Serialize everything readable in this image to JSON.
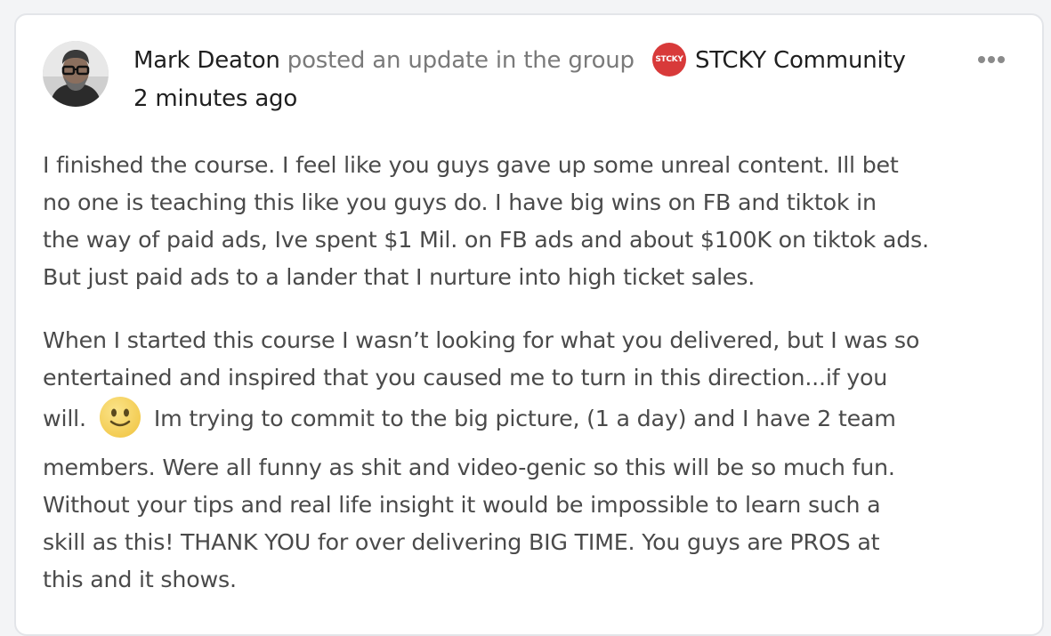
{
  "post": {
    "author": "Mark Deaton",
    "action_text": " posted an update in the group ",
    "group_badge_text": "STCKY",
    "group_name": "STCKY Community",
    "timestamp": "2 minutes ago",
    "more_icon": "more-horizontal-icon",
    "paragraphs": [
      {
        "lines": [
          "I finished the course. I feel like you guys gave up some unreal content. Ill bet",
          "no one is teaching this like you guys do. I have big wins on FB and tiktok in",
          "the way of paid ads, Ive spent $1 Mil. on FB ads and about $100K on tiktok ads.",
          "But just paid ads to a lander that I nurture into high ticket sales."
        ]
      },
      {
        "lines": [
          "When I started this course I wasn’t looking for what you delivered, but I was so",
          "entertained and inspired that you caused me to turn in this direction...if you",
          "members. Were all funny as shit and video-genic so this will be so much fun.",
          "Without your tips and real life insight it would be impossible to learn such a",
          "skill as this! THANK YOU for over delivering BIG TIME. You guys are PROS at",
          "this and it shows."
        ],
        "emoji_line_before": "will.",
        "emoji_line_after": "Im trying to commit to the big picture, (1 a day) and I have 2 team",
        "emoji_icon": "slightly-smiling-face-icon"
      }
    ]
  },
  "colors": {
    "group_badge": "#d83a3a",
    "author_text": "#1f1f1f",
    "meta_text": "#7a7a7a",
    "body_text": "#4a4a4a",
    "emoji_fill": "#f7d55a"
  }
}
